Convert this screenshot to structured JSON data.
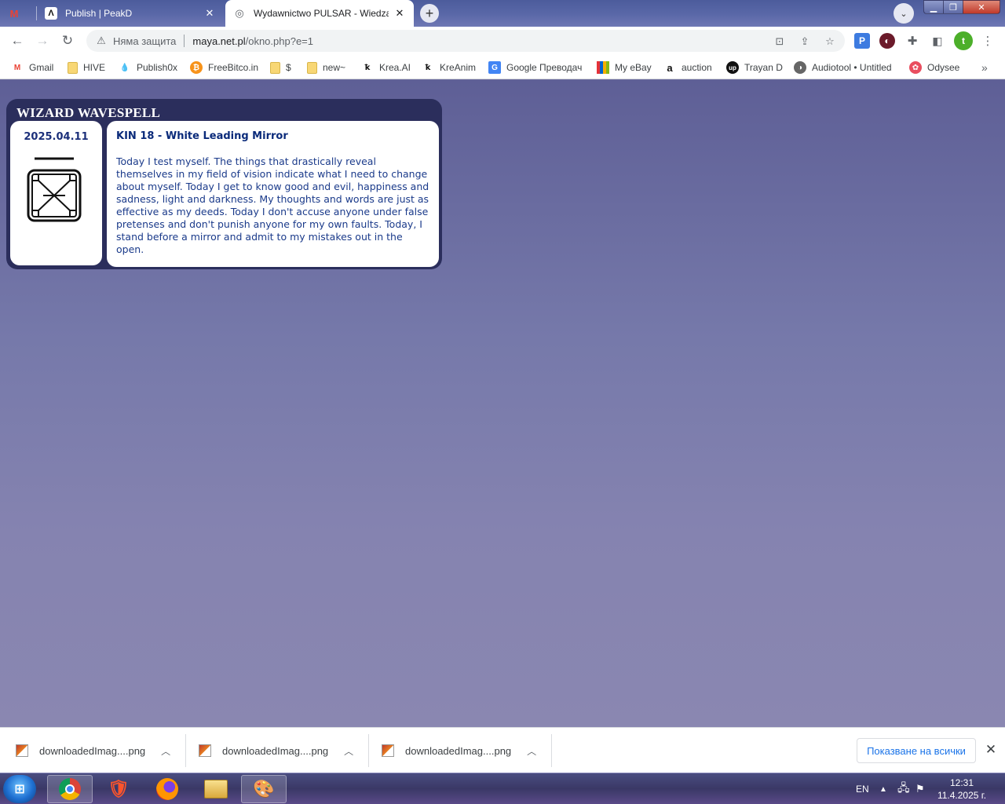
{
  "browser": {
    "tabs": [
      {
        "title": "",
        "icon": "gmail-icon"
      },
      {
        "title": "Publish | PeakD",
        "icon": "peakd-icon"
      },
      {
        "title": "Wydawnictwo PULSAR - Wiedza",
        "icon": "globe-icon"
      }
    ],
    "security_label": "Няма защита",
    "url_domain": "maya.net.pl",
    "url_path": "/okno.php?e=1",
    "profile_initial": "t"
  },
  "bookmarks": [
    {
      "label": "Gmail",
      "icon": "gmail-icon"
    },
    {
      "label": "HIVE",
      "icon": "folder-icon"
    },
    {
      "label": "Publish0x",
      "icon": "drop-icon"
    },
    {
      "label": "FreeBitco.in",
      "icon": "bitcoin-icon"
    },
    {
      "label": "$",
      "icon": "folder-icon"
    },
    {
      "label": "new~",
      "icon": "folder-icon"
    },
    {
      "label": "Krea.AI",
      "icon": "krea-icon"
    },
    {
      "label": "KreAnim",
      "icon": "krea-icon"
    },
    {
      "label": "Google Преводач",
      "icon": "translate-icon"
    },
    {
      "label": "My eBay",
      "icon": "ebay-icon"
    },
    {
      "label": "auction",
      "icon": "auction-icon"
    },
    {
      "label": "Trayan D",
      "icon": "upwork-icon"
    },
    {
      "label": "Audiotool • Untitled",
      "icon": "audiotool-icon"
    },
    {
      "label": "Odysee",
      "icon": "odysee-icon"
    }
  ],
  "wavespell": {
    "title": "WIZARD WAVESPELL",
    "date": "2025.04.11",
    "kin": "KIN 18 - White Leading Mirror",
    "description": "Today I test myself. The things that drastically reveal themselves in my field of vision indicate what I need to change about myself. Today I get to know good and evil, happiness and sadness, light and darkness. My thoughts and words are just as effective as my deeds. Today I don't accuse anyone under false pretenses and don't punish anyone for my own faults. Today, I stand before a mirror and admit to my mistakes out in the open."
  },
  "downloads": {
    "items": [
      {
        "name": "downloadedImag....png"
      },
      {
        "name": "downloadedImag....png"
      },
      {
        "name": "downloadedImag....png"
      }
    ],
    "show_all": "Показване на всички"
  },
  "taskbar": {
    "language": "EN",
    "time": "12:31",
    "date": "11.4.2025 г."
  }
}
